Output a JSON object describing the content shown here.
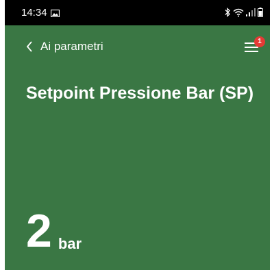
{
  "colors": {
    "background": "#3a7744",
    "status_bar": "#000000",
    "badge": "#e53a35",
    "text": "#ffffff"
  },
  "status_bar": {
    "time": "14:34",
    "icons": [
      "gallery-icon",
      "bluetooth-icon",
      "wifi-icon",
      "signal-icon",
      "battery-icon"
    ]
  },
  "nav": {
    "back_label": "Ai parametri",
    "menu_badge": "1",
    "icons": [
      "chevron-left-icon",
      "hamburger-menu-icon"
    ]
  },
  "main": {
    "title": "Setpoint Pressione Bar (SP)",
    "value": "2",
    "unit": "bar"
  }
}
